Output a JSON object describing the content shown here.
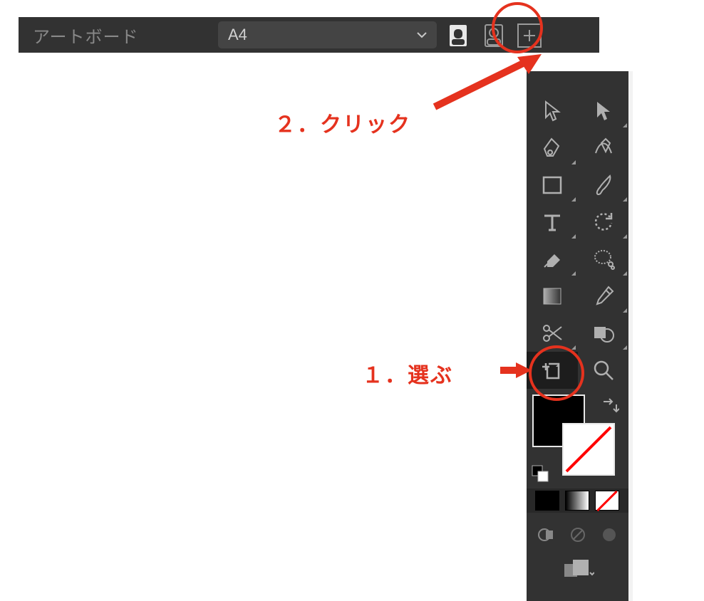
{
  "topbar": {
    "label": "アートボード",
    "preset_value": "A4",
    "orient_portrait_icon": "portrait-icon",
    "orient_landscape_icon": "landscape-icon",
    "add_icon": "plus-icon"
  },
  "tools": {
    "row0": {
      "a": "selection-tool",
      "b": "direct-selection-tool"
    },
    "row1": {
      "a": "pen-tool",
      "b": "curvature-tool"
    },
    "row2": {
      "a": "rectangle-tool",
      "b": "brush-tool"
    },
    "row3": {
      "a": "text-tool",
      "b": "rotate-tool"
    },
    "row4": {
      "a": "eraser-tool",
      "b": "scale-tool"
    },
    "row5": {
      "a": "gradient-tool",
      "b": "eyedropper-tool"
    },
    "row6": {
      "a": "scissors-tool",
      "b": "shape-builder-tool"
    },
    "row7": {
      "a": "artboard-tool",
      "b": "zoom-tool"
    }
  },
  "swatch": {
    "front_color": "#000000",
    "back_color": "#ffffff",
    "back_no_stroke": true
  },
  "fills": {
    "solid": "solid",
    "gradient": "gradient",
    "none": "none"
  },
  "viewbtns": {
    "a": "screen-mode-normal",
    "b": "screen-mode-full",
    "c": "screen-mode-presentation"
  },
  "doc_select": "document-select",
  "annotations": {
    "step1": "１．選ぶ",
    "step2": "２．クリック"
  }
}
